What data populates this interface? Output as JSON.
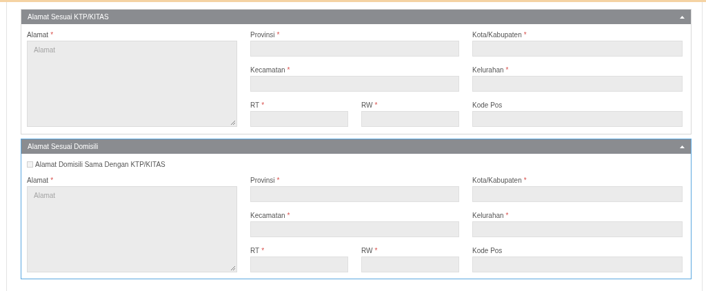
{
  "panels": [
    {
      "title": "Alamat Sesuai KTP/KITAS",
      "expanded": true,
      "focused": false,
      "fields": [
        {
          "kind": "textarea",
          "label": "Alamat",
          "mark": "*",
          "placeholder": "Alamat"
        },
        {
          "kind": "wide",
          "label": "Provinsi",
          "mark": "*"
        },
        {
          "kind": "wide",
          "label": "Kota/Kabupaten",
          "mark": "*"
        },
        {
          "kind": "wide",
          "label": "Kecamatan",
          "mark": "*"
        },
        {
          "kind": "wide",
          "label": "Kelurahan",
          "mark": "*"
        },
        {
          "kind": "narrow",
          "label": "RT",
          "mark": "*"
        },
        {
          "kind": "narrow",
          "label": "RW",
          "mark": "*"
        },
        {
          "kind": "wide",
          "label": "Kode Pos"
        }
      ]
    },
    {
      "title": "Alamat Sesuai Domisili",
      "expanded": true,
      "focused": true,
      "checkbox": {
        "label": "Alamat Domisili Sama Dengan KTP/KITAS",
        "checked": false
      },
      "fields": [
        {
          "kind": "textarea",
          "label": "Alamat",
          "mark": "*",
          "placeholder": "Alamat"
        },
        {
          "kind": "wide",
          "label": "Provinsi",
          "mark": "*"
        },
        {
          "kind": "wide",
          "label": "Kota/Kabupaten",
          "mark": "*"
        },
        {
          "kind": "wide",
          "label": "Kecamatan",
          "mark": "*"
        },
        {
          "kind": "wide",
          "label": "Kelurahan",
          "mark": "*"
        },
        {
          "kind": "narrow",
          "label": "RT",
          "mark": "*"
        },
        {
          "kind": "narrow",
          "label": "RW",
          "mark": "*"
        },
        {
          "kind": "wide",
          "label": "Kode Pos"
        }
      ]
    }
  ]
}
